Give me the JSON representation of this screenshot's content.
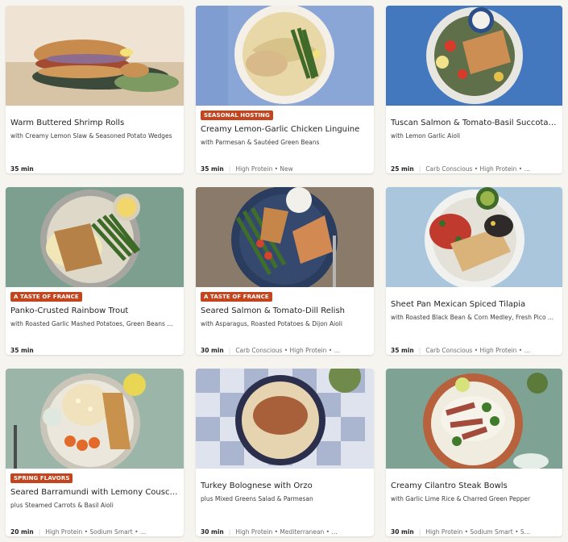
{
  "cards": [
    {
      "title": "Warm Buttered Shrimp Rolls",
      "subtitle": "with Creamy Lemon Slaw & Seasoned Potato Wedges",
      "badge": "",
      "time": "35 min",
      "tags": ""
    },
    {
      "title": "Creamy Lemon-Garlic Chicken Linguine",
      "subtitle": "with Parmesan & Sautéed Green Beans",
      "badge": "SEASONAL HOSTING",
      "time": "35 min",
      "tags": "High Protein • New"
    },
    {
      "title": "Tuscan Salmon & Tomato-Basil Succotash",
      "subtitle": "with Lemon Garlic Aioli",
      "badge": "",
      "time": "25 min",
      "tags": "Carb Conscious • High Protein • ..."
    },
    {
      "title": "Panko-Crusted Rainbow Trout",
      "subtitle": "with Roasted Garlic Mashed Potatoes, Green Beans ...",
      "badge": "A TASTE OF FRANCE",
      "time": "35 min",
      "tags": ""
    },
    {
      "title": "Seared Salmon & Tomato-Dill Relish",
      "subtitle": "with Asparagus, Roasted Potatoes & Dijon Aioli",
      "badge": "A TASTE OF FRANCE",
      "time": "30 min",
      "tags": "Carb Conscious • High Protein • ..."
    },
    {
      "title": "Sheet Pan Mexican Spiced Tilapia",
      "subtitle": "with Roasted Black Bean & Corn Medley, Fresh Pico ...",
      "badge": "",
      "time": "35 min",
      "tags": "Carb Conscious • High Protein • ..."
    },
    {
      "title": "Seared Barramundi with Lemony Couscous",
      "subtitle": "plus Steamed Carrots & Basil Aioli",
      "badge": "SPRING FLAVORS",
      "time": "20 min",
      "tags": "High Protein • Sodium Smart • ..."
    },
    {
      "title": "Turkey Bolognese with Orzo",
      "subtitle": "plus Mixed Greens Salad & Parmesan",
      "badge": "",
      "time": "30 min",
      "tags": "High Protein • Mediterranean • ..."
    },
    {
      "title": "Creamy Cilantro Steak Bowls",
      "subtitle": "with Garlic Lime Rice & Charred Green Pepper",
      "badge": "",
      "time": "30 min",
      "tags": "High Protein • Sodium Smart • S..."
    }
  ],
  "colors": {
    "badge": "#c4451d",
    "page_background": "#f6f4ef"
  }
}
